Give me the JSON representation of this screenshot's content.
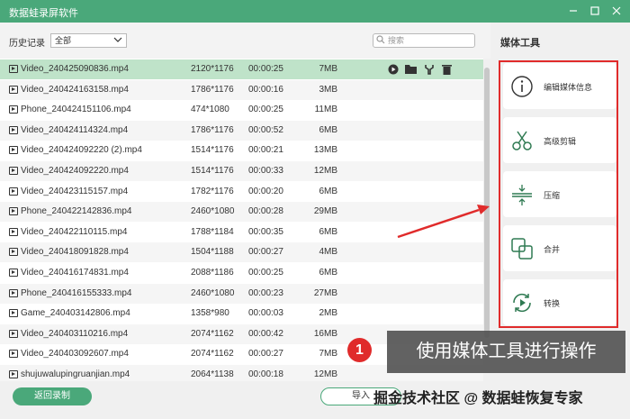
{
  "window": {
    "title": "数据蛙录屏软件"
  },
  "toolbar": {
    "history_label": "历史记录",
    "history_value": "全部",
    "search_placeholder": "搜索"
  },
  "files": [
    {
      "name": "Video_240425090836.mp4",
      "res": "2120*1176",
      "dur": "00:00:25",
      "size": "7MB"
    },
    {
      "name": "Video_240424163158.mp4",
      "res": "1786*1176",
      "dur": "00:00:16",
      "size": "3MB"
    },
    {
      "name": "Phone_240424151106.mp4",
      "res": "474*1080",
      "dur": "00:00:25",
      "size": "11MB"
    },
    {
      "name": "Video_240424114324.mp4",
      "res": "1786*1176",
      "dur": "00:00:52",
      "size": "6MB"
    },
    {
      "name": "Video_240424092220 (2).mp4",
      "res": "1514*1176",
      "dur": "00:00:21",
      "size": "13MB"
    },
    {
      "name": "Video_240424092220.mp4",
      "res": "1514*1176",
      "dur": "00:00:33",
      "size": "12MB"
    },
    {
      "name": "Video_240423115157.mp4",
      "res": "1782*1176",
      "dur": "00:00:20",
      "size": "6MB"
    },
    {
      "name": "Phone_240422142836.mp4",
      "res": "2460*1080",
      "dur": "00:00:28",
      "size": "29MB"
    },
    {
      "name": "Video_240422110115.mp4",
      "res": "1788*1184",
      "dur": "00:00:35",
      "size": "6MB"
    },
    {
      "name": "Video_240418091828.mp4",
      "res": "1504*1188",
      "dur": "00:00:27",
      "size": "4MB"
    },
    {
      "name": "Video_240416174831.mp4",
      "res": "2088*1186",
      "dur": "00:00:25",
      "size": "6MB"
    },
    {
      "name": "Phone_240416155333.mp4",
      "res": "2460*1080",
      "dur": "00:00:23",
      "size": "27MB"
    },
    {
      "name": "Game_240403142806.mp4",
      "res": "1358*980",
      "dur": "00:00:03",
      "size": "2MB"
    },
    {
      "name": "Video_240403110216.mp4",
      "res": "2074*1162",
      "dur": "00:00:42",
      "size": "16MB"
    },
    {
      "name": "Video_240403092607.mp4",
      "res": "2074*1162",
      "dur": "00:00:27",
      "size": "7MB"
    },
    {
      "name": "shujuwalupingruanjian.mp4",
      "res": "2064*1138",
      "dur": "00:00:18",
      "size": "12MB"
    }
  ],
  "bottom": {
    "back_label": "返回录制",
    "import_label": "导入"
  },
  "sidebar": {
    "title": "媒体工具",
    "tools": [
      {
        "label": "编辑媒体信息",
        "icon": "info-icon"
      },
      {
        "label": "高级剪辑",
        "icon": "scissors-icon"
      },
      {
        "label": "压缩",
        "icon": "compress-icon"
      },
      {
        "label": "合并",
        "icon": "merge-icon"
      },
      {
        "label": "转换",
        "icon": "convert-icon"
      }
    ]
  },
  "annotation": {
    "step": "1",
    "text": "使用媒体工具进行操作"
  },
  "watermark": "掘金技术社区 @ 数据蛙恢复专家",
  "colors": {
    "accent": "#4aa87a",
    "highlight": "#e02b2b",
    "selected_row": "#bfe3c9"
  }
}
